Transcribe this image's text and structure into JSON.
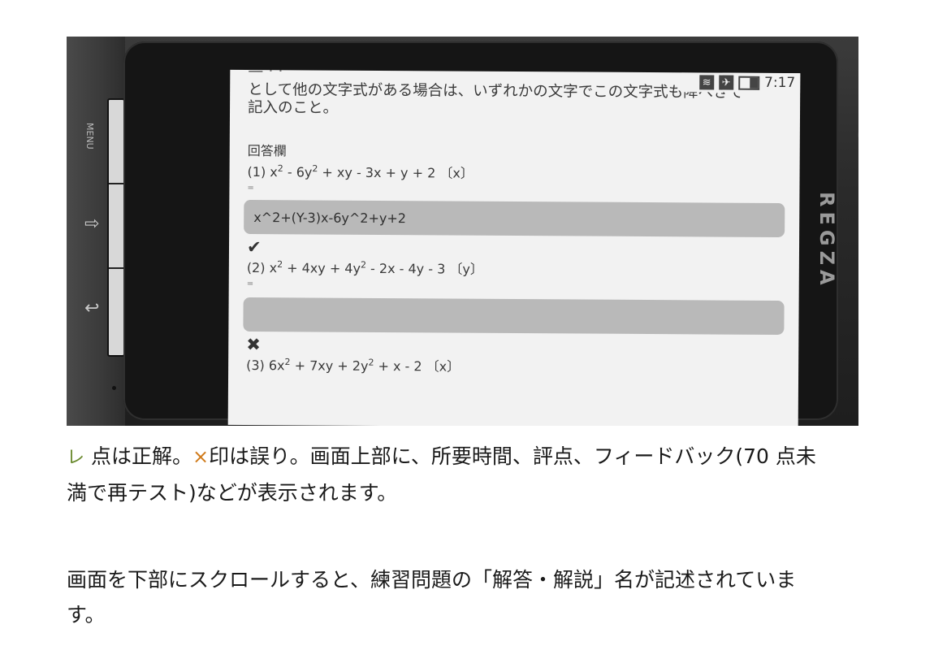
{
  "phone": {
    "menu_label": "MENU",
    "home_symbol": "⇨",
    "back_symbol": "↩",
    "brand": "REGZA"
  },
  "status_bar": {
    "icons": [
      "wifi-icon",
      "airplane-icon",
      "battery-icon"
    ],
    "time": "7:17"
  },
  "screen": {
    "instruction_line1": "として他の文字式がある場合は、いずれかの文字でこの文字式も降べきで",
    "instruction_line2": "記入のこと。",
    "answer_section_title": "回答欄",
    "q1": {
      "prefix": "(1) x",
      "sup1": "2",
      "mid1": " - 6y",
      "sup2": "2",
      "rest": " + xy - 3x + y + 2 〔x〕",
      "equals": "=",
      "answer": "x^2+(Y-3)x-6y^2+y+2",
      "result": "✔"
    },
    "q2": {
      "prefix": "(2) x",
      "sup1": "2",
      "mid1": " + 4xy + 4y",
      "sup2": "2",
      "rest": " - 2x - 4y - 3 〔y〕",
      "equals": "=",
      "answer": "",
      "result": "✖"
    },
    "q3": {
      "prefix": "(3) 6x",
      "sup1": "2",
      "mid1": " + 7xy + 2y",
      "sup2": "2",
      "rest": " + x - 2 〔x〕"
    }
  },
  "caption": {
    "para1_check": "レ",
    "para1_a": " 点は正解。",
    "para1_x": "×",
    "para1_b": "印は誤り。画面上部に、所要時間、評点、フィードバック(70 点未",
    "para1_line2": "満で再テスト)などが表示されます。",
    "para2_line1": "画面を下部にスクロールすると、練習問題の「解答・解説」名が記述されていま",
    "para2_line2": "す。"
  },
  "colors": {
    "check_mark": "#6a8a2e",
    "cross_mark": "#d07a1a",
    "answer_field": "#b9b9b9",
    "screen_bg": "#f2f2f2"
  }
}
